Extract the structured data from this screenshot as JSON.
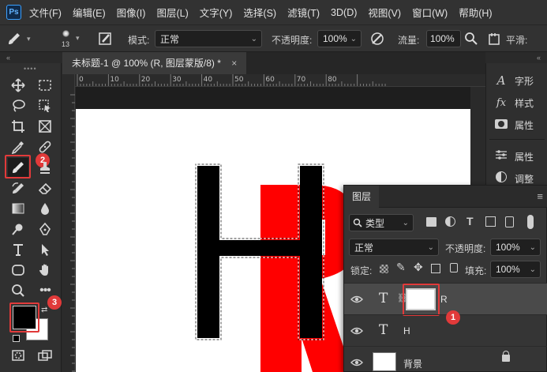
{
  "app": {
    "logo": "Ps"
  },
  "menu": [
    "文件(F)",
    "编辑(E)",
    "图像(I)",
    "图层(L)",
    "文字(Y)",
    "选择(S)",
    "滤镜(T)",
    "3D(D)",
    "视图(V)",
    "窗口(W)",
    "帮助(H)"
  ],
  "options": {
    "brush_size": "13",
    "mode_label": "模式:",
    "mode_value": "正常",
    "opacity_label": "不透明度:",
    "opacity_value": "100%",
    "flow_label": "流量:",
    "flow_value": "100%",
    "smooth_label": "平滑:"
  },
  "document": {
    "tab_title": "未标题-1 @ 100% (R, 图层蒙版/8) *",
    "ruler_ticks": [
      "0",
      "10",
      "20",
      "30",
      "40",
      "50",
      "60",
      "70",
      "80"
    ],
    "canvas_text_1": "H",
    "canvas_text_2": "R"
  },
  "right_dock": {
    "items": [
      "字形",
      "样式",
      "属性",
      "属性",
      "调整"
    ]
  },
  "layers_panel": {
    "title": "图层",
    "filter_label": "类型",
    "blend_mode": "正常",
    "opacity_label": "不透明度:",
    "opacity_value": "100%",
    "lock_label": "锁定:",
    "fill_label": "填充:",
    "fill_value": "100%",
    "layers": [
      {
        "name": "R",
        "type": "text"
      },
      {
        "name": "H",
        "type": "text"
      },
      {
        "name": "背景",
        "type": "background"
      }
    ]
  },
  "annotations": [
    "1",
    "2",
    "3"
  ],
  "colors": {
    "accent_red": "#e13a3a",
    "canvas_red": "#ff0000",
    "foreground_color": "#000000",
    "background_color": "#ffffff"
  }
}
